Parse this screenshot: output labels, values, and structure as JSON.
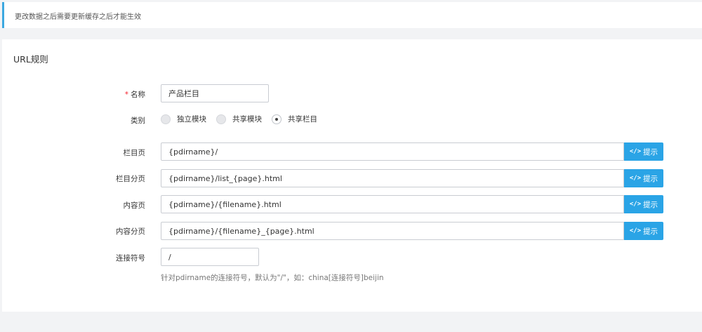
{
  "notice": {
    "text": "更改数据之后需要更新缓存之后才能生效"
  },
  "card": {
    "title": "URL规则"
  },
  "form": {
    "name": {
      "label": "名称",
      "required_mark": "*",
      "value": "产品栏目"
    },
    "category": {
      "label": "类别",
      "options": [
        {
          "label": "独立模块",
          "checked": false
        },
        {
          "label": "共享模块",
          "checked": false
        },
        {
          "label": "共享栏目",
          "checked": true
        }
      ]
    },
    "rules": [
      {
        "label": "栏目页",
        "value": "{pdirname}/",
        "button": "提示"
      },
      {
        "label": "栏目分页",
        "value": "{pdirname}/list_{page}.html",
        "button": "提示"
      },
      {
        "label": "内容页",
        "value": "{pdirname}/{filename}.html",
        "button": "提示"
      },
      {
        "label": "内容分页",
        "value": "{pdirname}/{filename}_{page}.html",
        "button": "提示"
      }
    ],
    "connector": {
      "label": "连接符号",
      "value": "/",
      "help": "针对pdirname的连接符号，默认为\"/\"，如：china[连接符号]beijin"
    }
  },
  "icons": {
    "hint_icon": "code-icon"
  },
  "colors": {
    "accent": "#2aa4e6",
    "notice_border": "#3ca8e0",
    "required": "#f5222d"
  }
}
